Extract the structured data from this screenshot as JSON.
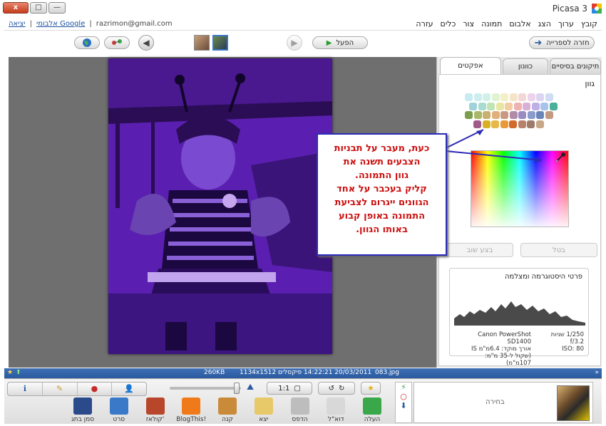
{
  "window": {
    "title": "Picasa 3",
    "close_label": "x",
    "max_label": "□",
    "min_label": "—"
  },
  "menu": [
    "קובץ",
    "ערוך",
    "הצג",
    "אלבום",
    "תמונה",
    "צור",
    "כלים",
    "עזרה"
  ],
  "user": {
    "email": "razrimon@gmail.com",
    "web_albums": "אלבומי Google",
    "sign_out": "יציאה"
  },
  "toolbar": {
    "back_to_library": "חזרה לספרייה",
    "play_label": "הפעל"
  },
  "tabs": {
    "basic": "תיקונים בסיסיים",
    "tuning": "כוונון",
    "effects": "אפקטים"
  },
  "panel": {
    "section_title": "גוון",
    "cancel_label": "בטל",
    "apply_label": "בצע שוב",
    "histogram_title": "פרטי היסטוגרמה ומצלמה",
    "camera_model": "Canon PowerShot SD1400",
    "focal_length": "אורך מוקד: 6.4מ\"מ IS",
    "equivalent": "(שקול ל-35 מ\"מ: 107מ\"מ)",
    "exposure": "1/250 שניות",
    "aperture": "f/3.2",
    "iso": "ISO: 80"
  },
  "hex_colors": [
    [
      "#c8eaf3",
      "#cdeef0",
      "#d2f1e6",
      "#e0f3d0",
      "#f2f0c6",
      "#f5e4c8",
      "#f3d6d6",
      "#ecd3ec",
      "#ddd3f2",
      "#d0dcf4"
    ],
    [
      "#9fd3d9",
      "#a9dcd0",
      "#c0e4b4",
      "#e8e6a2",
      "#f2cca2",
      "#eeb2b2",
      "#dbb0d8",
      "#bdb0e6",
      "#a8c2ea",
      "#4bb09a"
    ],
    [
      "#7a9e4c",
      "#a8b868",
      "#c9b070",
      "#e0b07a",
      "#c99a82",
      "#b08aa8",
      "#9a8ac2",
      "#8a9acb",
      "#6a86b8",
      "#c29a82"
    ],
    [
      "#a05a8a",
      "#d9b024",
      "#e6b84a",
      "#e89a3a",
      "#d26a2a",
      "#b8826a",
      "#9e7a6a",
      "#c8a688"
    ]
  ],
  "callout_text": [
    "כעת, מעבר על תבניות",
    "הצבעים תשנה את",
    "גוון התמונה.",
    "קליק בעכבר על אחד",
    "הגוונים ייגרום לצביעת",
    "התמונה באופן קבוע",
    "באותו הגוון."
  ],
  "status": {
    "filename": "083.jpg",
    "datetime": "14:22:21 20/03/2011",
    "dimensions": "1134x1512 פיקסלים",
    "filesize": "260KB"
  },
  "tray": {
    "selection_label": "בחירה",
    "tools": [
      {
        "label": "העלה",
        "icon": "upload-icon",
        "color": "#3aa84a"
      },
      {
        "label": "דוא\"ל",
        "icon": "email-icon",
        "color": "#d8d8d8"
      },
      {
        "label": "הדפס",
        "icon": "print-icon",
        "color": "#bdbdbd"
      },
      {
        "label": "יצא",
        "icon": "export-folder-icon",
        "color": "#e7c96a"
      },
      {
        "label": "קנה",
        "icon": "shop-icon",
        "color": "#c98a3a"
      },
      {
        "label": "BlogThis!",
        "icon": "blogger-icon",
        "color": "#f07a1a"
      },
      {
        "label": "קולאז'",
        "icon": "collage-icon",
        "color": "#b8462a"
      },
      {
        "label": "סרט",
        "icon": "movie-icon",
        "color": "#3a78c8"
      },
      {
        "label": "סמן בתג",
        "icon": "geotag-icon",
        "color": "#2a4a8a"
      }
    ]
  }
}
